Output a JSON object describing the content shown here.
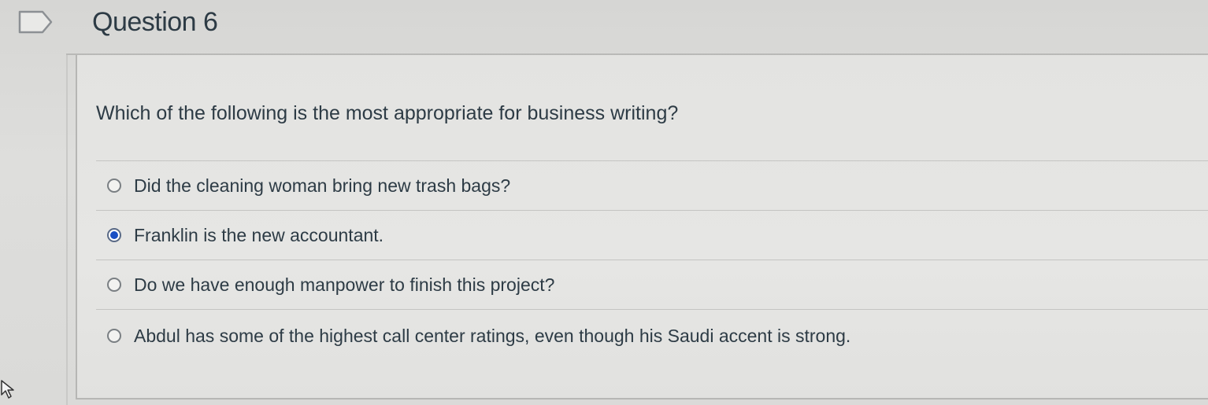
{
  "question": {
    "title": "Question 6",
    "text": "Which of the following is the most appropriate for business writing?",
    "flag_icon": "flag-icon",
    "answers": [
      {
        "label": "Did the cleaning woman bring new trash bags?",
        "selected": false
      },
      {
        "label": "Franklin is the new accountant.",
        "selected": true
      },
      {
        "label": "Do we have enough manpower to finish this project?",
        "selected": false
      },
      {
        "label": "Abdul has some of the highest call center ratings, even though his Saudi accent is strong.",
        "selected": false
      }
    ]
  },
  "colors": {
    "text": "#2d3b45",
    "selected_radio": "#1a4fc4",
    "background": "#dededc"
  },
  "pointer_icon": "mouse-pointer-icon"
}
